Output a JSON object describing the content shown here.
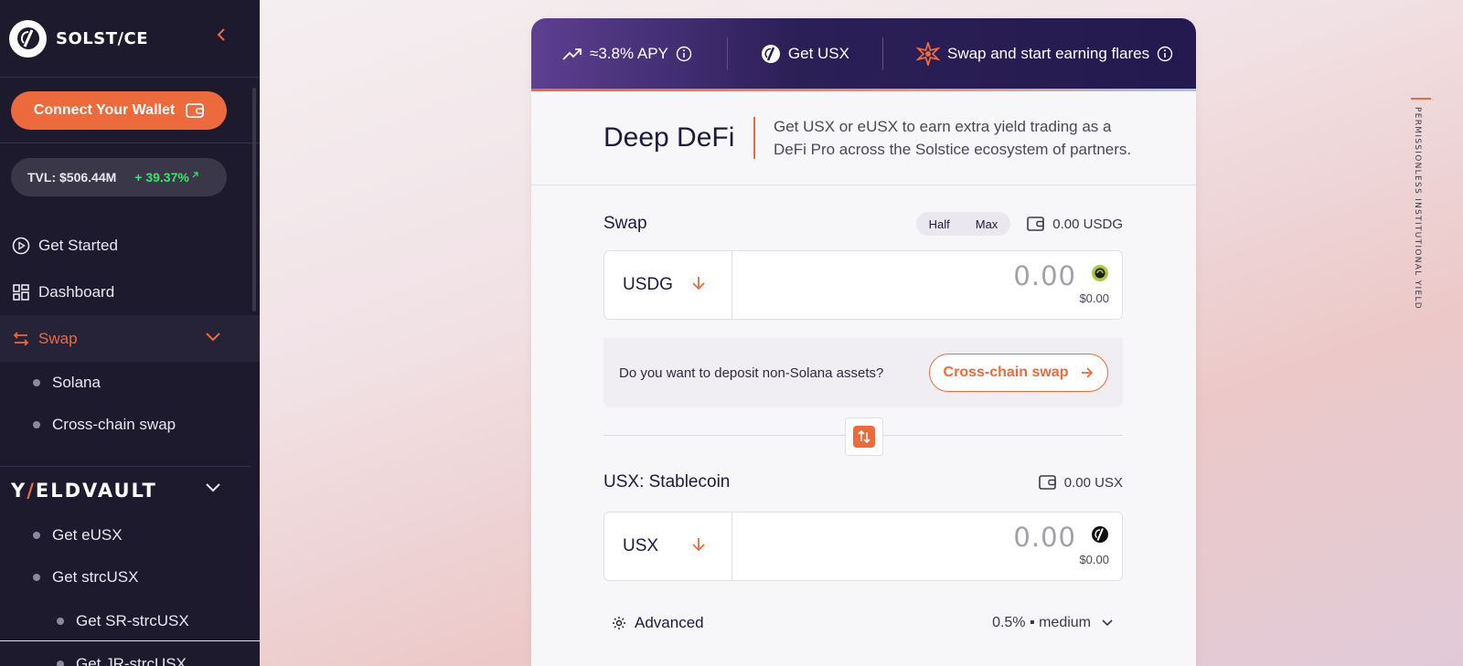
{
  "sidebar": {
    "brand": "SOLST/CE",
    "connect_wallet": "Connect Your Wallet",
    "tvl_label": "TVL: $506.44M",
    "tvl_change": "+ 39.37%",
    "nav": {
      "get_started": "Get Started",
      "dashboard": "Dashboard",
      "swap": "Swap",
      "solana": "Solana",
      "cross_chain": "Cross-chain swap"
    },
    "yieldvault": {
      "brand_pre": "Y",
      "brand_slash": "/",
      "brand_post": "ELDVAULT",
      "get_eusx": "Get eUSX",
      "get_strcusx": "Get strcUSX",
      "get_sr": "Get SR-strcUSX",
      "get_jr": "Get JR-strcUSX"
    }
  },
  "header": {
    "apy": "≈3.8% APY",
    "get_usx": "Get USX",
    "flares": "Swap and start earning flares"
  },
  "deep_defi": {
    "title": "Deep DeFi",
    "description": "Get USX or eUSX to earn extra yield trading as a DeFi Pro across the Solstice ecosystem of partners."
  },
  "swap": {
    "title": "Swap",
    "half": "Half",
    "max": "Max",
    "balance": "0.00 USDG",
    "token": "USDG",
    "amount": "0.00",
    "usd": "$0.00",
    "cross_question": "Do you want to deposit non-Solana assets?",
    "cross_button": "Cross-chain swap"
  },
  "receive": {
    "title": "USX: Stablecoin",
    "balance": "0.00 USX",
    "token": "USX",
    "amount": "0.00",
    "usd": "$0.00"
  },
  "advanced": {
    "label": "Advanced",
    "slippage": "0.5% ▪ medium"
  },
  "side_tag": "PERMISSIONLESS INSTITUTIONAL YIELD",
  "colors": {
    "accent": "#ec6a3b",
    "sidebar_bg": "#1d1a2e",
    "header_bg": "#241a4f",
    "tvl_positive": "#3fe26f"
  }
}
